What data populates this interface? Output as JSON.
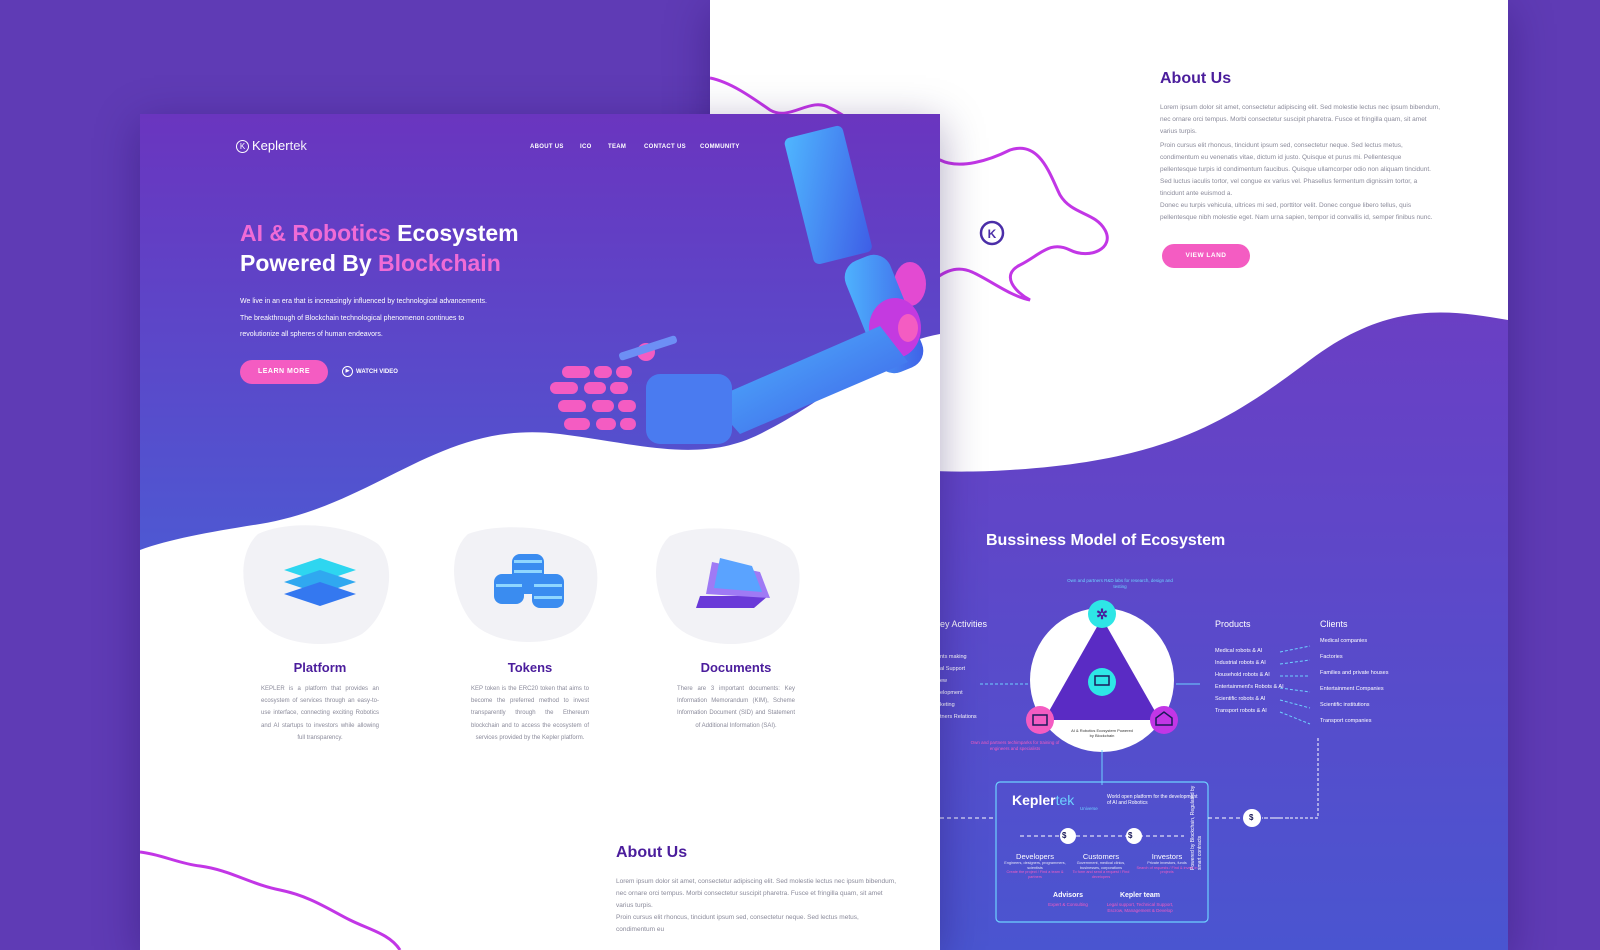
{
  "brand": {
    "logo_text_bold": "Kepler",
    "logo_text_light": "tek"
  },
  "nav": [
    "ABOUT US",
    "ICO",
    "TEAM",
    "CONTACT US",
    "COMMUNITY"
  ],
  "hero": {
    "title_l1_accent": "AI & Robotics",
    "title_l1_rest": " Ecosystem",
    "title_l2_start": "Powered By ",
    "title_l2_accent": "Blockchain",
    "description": "We live in an era that is increasingly influenced by technological advancements. The breakthrough of Blockchain technological phenomenon continues to revolutionize all spheres of human endeavors.",
    "learn_more": "LEARN MORE",
    "watch_video": "WATCH VIDEO"
  },
  "features": [
    {
      "title": "Platform",
      "icon": "layers-icon",
      "text": "KEPLER is a platform that provides an ecosystem of services through an easy-to-use interface, connecting exciting Robotics and AI startups to investors while allowing full transparency."
    },
    {
      "title": "Tokens",
      "icon": "coins-icon",
      "text": "KEP token is the ERC20 token that aims to become the preferred method to invest transparently through the Ethereum blockchain and to access the ecosystem of services provided by the Kepler platform."
    },
    {
      "title": "Documents",
      "icon": "documents-icon",
      "text": "There are 3 important documents: Key Information Memorandum (KIM), Scheme Information Document (SID) and Statement of Additional Information (SAI)."
    }
  ],
  "about": {
    "title": "About Us",
    "p1": "Lorem ipsum dolor sit amet, consectetur adipiscing elit. Sed molestie lectus nec ipsum bibendum, nec ornare orci tempus. Morbi consectetur suscipit pharetra. Fusce et fringilla quam, sit amet varius turpis.",
    "p2": "Proin cursus elit rhoncus, tincidunt ipsum sed, consectetur neque. Sed lectus metus, condimentum eu venenatis vitae, dictum id justo. Quisque et purus mi. Pellentesque pellentesque turpis id condimentum faucibus. Quisque ullamcorper odio non aliquam tincidunt. Sed luctus iaculis tortor, vel congue ex varius vel. Phasellus fermentum dignissim tortor, a tincidunt ante euismod a.",
    "p3": "Donec eu turpis vehicula, ultrices mi sed, porttitor velit. Donec congue libero tellus, quis pellentesque nibh molestie eget. Nam urna sapien, tempor id convallis id, semper finibus nunc.",
    "view_land": "VIEW LAND"
  },
  "bottom_about": {
    "title": "About Us",
    "p1": "Lorem ipsum dolor sit amet, consectetur adipiscing elit. Sed molestie lectus nec ipsum bibendum, nec ornare orci tempus. Morbi consectetur suscipit pharetra. Fusce et fringilla quam, sit amet varius turpis.",
    "p2": "Proin cursus elit rhoncus, tincidunt ipsum sed, consectetur neque. Sed lectus metus, condimentum eu"
  },
  "diagram": {
    "title": "Bussiness Model of Ecosystem",
    "key_activities": "ey Activities",
    "activity_items": [
      "nts making",
      "al Support",
      "ew",
      "elopment",
      "keting",
      "tners Relations"
    ],
    "products_title": "Products",
    "products": [
      "Medical robots & AI",
      "Industrial robots & AI",
      "Household robots & AI",
      "Entertainment's Robots & AI",
      "Scientific robots & AI",
      "Transport robots & AI"
    ],
    "clients_title": "Clients",
    "clients": [
      "Medical companies",
      "Factories",
      "Families and private houses",
      "Entertainment Companies",
      "Scientific institutions",
      "Transport companies"
    ],
    "top_note": "Own and partners R&D labs for research, design and testing",
    "bottom_note": "Own and partners techimparks for training of engineers and specialists",
    "center_label": "AI & Robotics Ecosystem Powered by Blockchain",
    "platform_desc": "World open platform for the development of AI and Robotics",
    "universe": "Universe",
    "side_note": "Powered by Blockchain, Regulated by smart contracts",
    "dollar": "$",
    "roles": [
      {
        "name": "Developers",
        "sub": "Engineers, designers, programmers, scientists",
        "action": "Create the project / Find a team & partners"
      },
      {
        "name": "Customers",
        "sub": "Government, medical clinics, businesses, corporations",
        "action": "To form and send a request / Find developers"
      },
      {
        "name": "Investors",
        "sub": "Private investors, funds",
        "action": "Search of requests / Find & invest in projects"
      }
    ],
    "advisors": {
      "name": "Advisors",
      "sub": "Expert & Consulting"
    },
    "team": {
      "name": "Kepler team",
      "sub": "Legal support, Technical Support, Escrow, Management & Develop"
    }
  },
  "colors": {
    "purple": "#5f3bb5",
    "accent_pink": "#f45cc2",
    "title_purple": "#4b1d9c",
    "cyan": "#2ee6e6"
  }
}
